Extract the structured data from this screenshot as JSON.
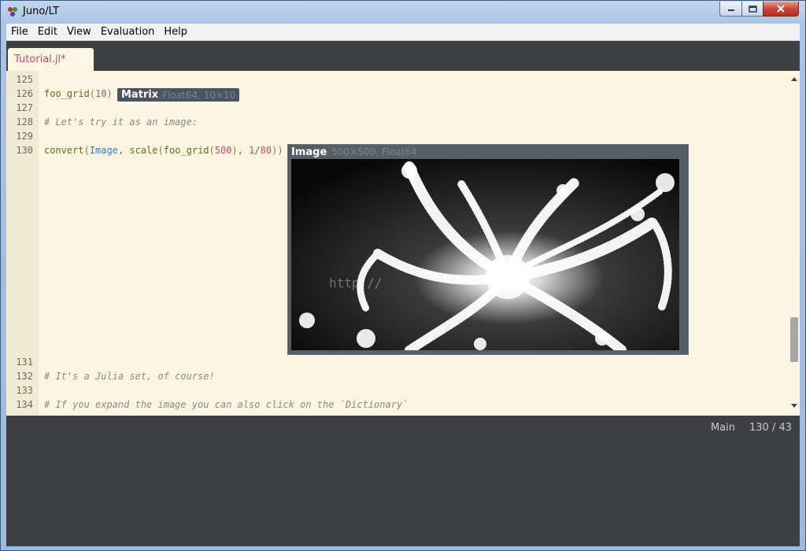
{
  "window": {
    "title": "Juno/LT",
    "controls": {
      "minimize": "minimize-icon",
      "maximize": "maximize-icon",
      "close": "close-icon"
    }
  },
  "menu": [
    "File",
    "Edit",
    "View",
    "Evaluation",
    "Help"
  ],
  "tabs": [
    {
      "label": "Tutorial.jl*",
      "active": true
    }
  ],
  "editor": {
    "lines": [
      {
        "n": "125",
        "text": ""
      },
      {
        "n": "126",
        "text": "foo_grid(10)"
      },
      {
        "n": "127",
        "text": ""
      },
      {
        "n": "128",
        "text": "# Let's try it as an image:"
      },
      {
        "n": "129",
        "text": ""
      },
      {
        "n": "130",
        "text": "convert(Image, scale(foo_grid(500), 1/80))"
      },
      {
        "n": "131",
        "text": ""
      },
      {
        "n": "132",
        "text": "# It's a Julia set, of course!"
      },
      {
        "n": "133",
        "text": ""
      },
      {
        "n": "134",
        "text": "# If you expand the image you can also click on the `Dictionary`"
      }
    ],
    "matrix_badge": {
      "title": "Matrix",
      "subtitle": "Float64, 10×10"
    },
    "image_badge": {
      "title": "Image",
      "subtitle": "500×500, Float64"
    },
    "watermark": "http://"
  },
  "status": {
    "module": "Main",
    "position": "130 / 43"
  },
  "colors": {
    "editor_bg": "#fcf5e2",
    "chrome_bg": "#3d3f42",
    "tab_text": "#c0506e",
    "comment": "#8a8a8a",
    "number": "#c0506e",
    "type": "#3b7bbf"
  }
}
